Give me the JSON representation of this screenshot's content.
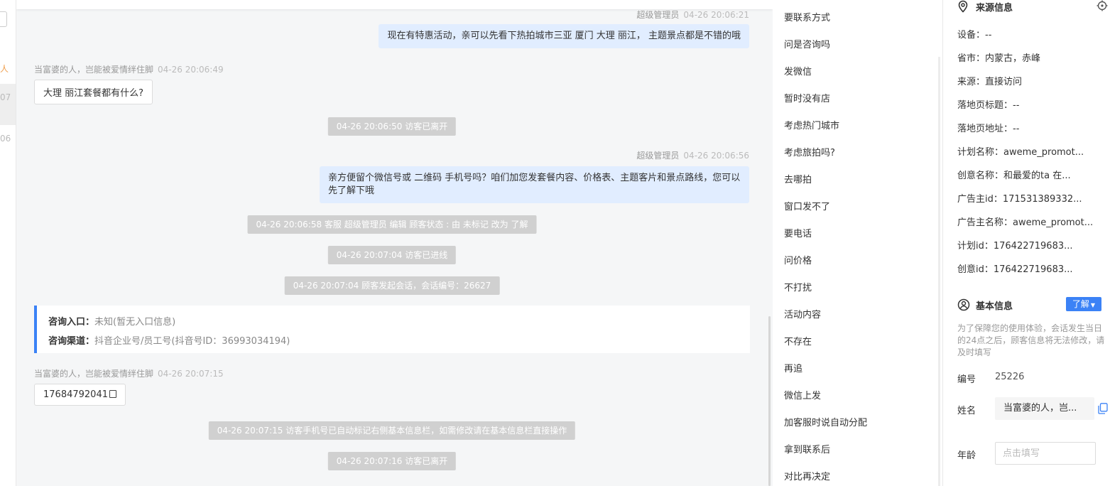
{
  "left_strip": {
    "mark1": "人",
    "mark2": "07",
    "mark3": "06"
  },
  "chat": {
    "msg1": {
      "sender": "超级管理员",
      "time": "04-26 20:06:21",
      "text": "现在有特惠活动，亲可以先看下热拍城市三亚 厦门 大理 丽江， 主题景点都是不错的哦"
    },
    "msg2": {
      "sender": "当富婆的人，岂能被爱情绊住脚",
      "time": "04-26 20:06:49",
      "text": "大理 丽江套餐都有什么?"
    },
    "sys1": "04-26 20:06:50 访客已离开",
    "msg3": {
      "sender": "超级管理员",
      "time": "04-26 20:06:56",
      "text_line1": "亲方便留个微信号或 二维码 手机号吗？咱们加您发套餐内容、价格表、主题客片和景点路线，您可以",
      "text_line2": "先了解下哦"
    },
    "sys2": "04-26 20:06:58 客服 超级管理员 编辑 顾客状态 : 由 未标记 改为 了解",
    "sys3": "04-26 20:07:04 访客已进线",
    "sys4": "04-26 20:07:04 顾客发起会话，会话编号：26627",
    "entry": {
      "label1": "咨询入口：",
      "value1": "未知(暂无入口信息)",
      "label2": "咨询渠道：",
      "value2": "抖音企业号/员工号(抖音号ID：36993034194)"
    },
    "msg4": {
      "sender": "当富婆的人，岂能被爱情绊住脚",
      "time": "04-26 20:07:15",
      "text": "17684792041"
    },
    "sys5": "04-26 20:07:15 访客手机号已自动标记右侧基本信息栏，如需修改请在基本信息栏直接操作",
    "sys6": "04-26 20:07:16 访客已离开"
  },
  "quick_replies": [
    "要联系方式",
    "问是咨询吗",
    "发微信",
    "暂时没有店",
    "考虑热门城市",
    "考虑旅拍吗?",
    "去哪拍",
    "窗口发不了",
    "要电话",
    "问价格",
    "不打扰",
    "活动内容",
    "不存在",
    "再追",
    "微信上发",
    "加客服时说自动分配",
    "拿到联系后",
    "对比再决定"
  ],
  "source_info": {
    "title": "来源信息",
    "fields": [
      "设备：--",
      "省市：内蒙古，赤峰",
      "来源：直接访问",
      "落地页标题：--",
      "落地页地址：--",
      "计划名称：aweme_promot...",
      "创意名称：和最爱的ta 在...",
      "广告主id：171531389332...",
      "广告主名称：aweme_promot...",
      "计划id：176422719683...",
      "创意id：176422719683..."
    ]
  },
  "basic_info": {
    "title": "基本信息",
    "status_tag": "了解",
    "tip": "为了保障您的使用体验，会话发生当日的24点之后，顾客信息将无法修改，请及时填写",
    "id_label": "编号",
    "id_value": "25226",
    "name_label": "姓名",
    "name_value": "当富婆的人，岂...",
    "age_label": "年龄",
    "age_placeholder": "点击填写"
  },
  "colors": {
    "accent": "#3b82f6",
    "bubble_right": "#e1edff",
    "system_msg": "#d0d0d0",
    "chat_bg": "#f5f6f7"
  }
}
